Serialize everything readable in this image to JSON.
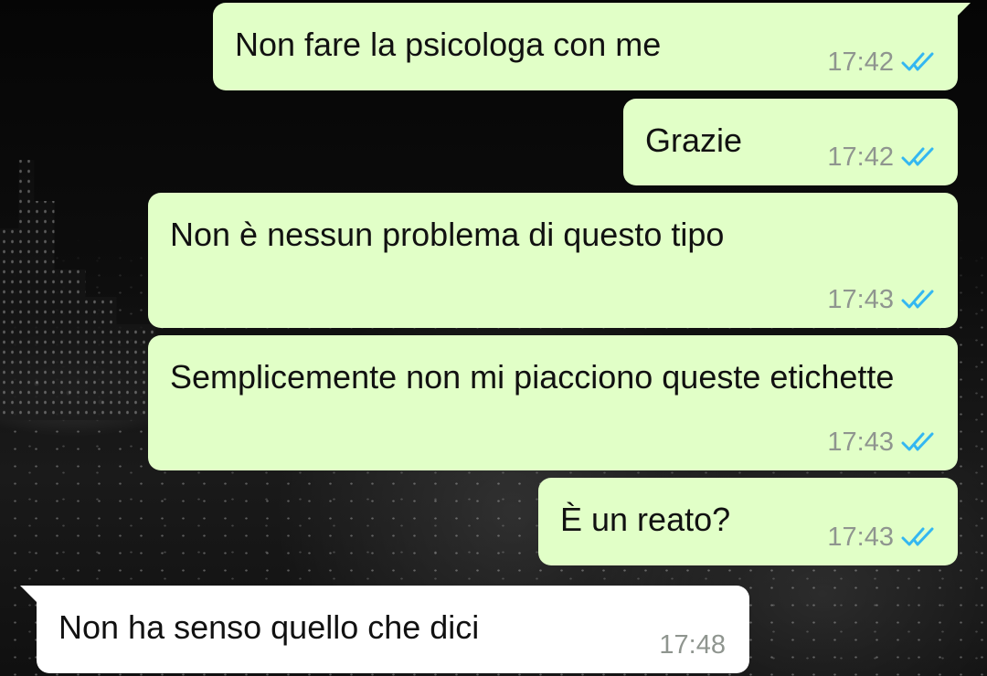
{
  "chat": {
    "messages": [
      {
        "direction": "outgoing",
        "text": "Non fare la psicologa con me",
        "time": "17:42",
        "status_icon": "double-check-read-icon"
      },
      {
        "direction": "outgoing",
        "text": "Grazie",
        "time": "17:42",
        "status_icon": "double-check-read-icon"
      },
      {
        "direction": "outgoing",
        "text": "Non è nessun problema di questo tipo",
        "time": "17:43",
        "status_icon": "double-check-read-icon"
      },
      {
        "direction": "outgoing",
        "text": "Semplicemente non mi piacciono queste etichette",
        "time": "17:43",
        "status_icon": "double-check-read-icon"
      },
      {
        "direction": "outgoing",
        "text": "È un reato?",
        "time": "17:43",
        "status_icon": "double-check-read-icon"
      },
      {
        "direction": "incoming",
        "text": "Non ha senso quello che dici",
        "time": "17:48"
      }
    ]
  },
  "colors": {
    "outgoing_bubble": "#e1ffc7",
    "incoming_bubble": "#ffffff",
    "timestamp": "#8f958f",
    "read_tick": "#34b7f1"
  }
}
